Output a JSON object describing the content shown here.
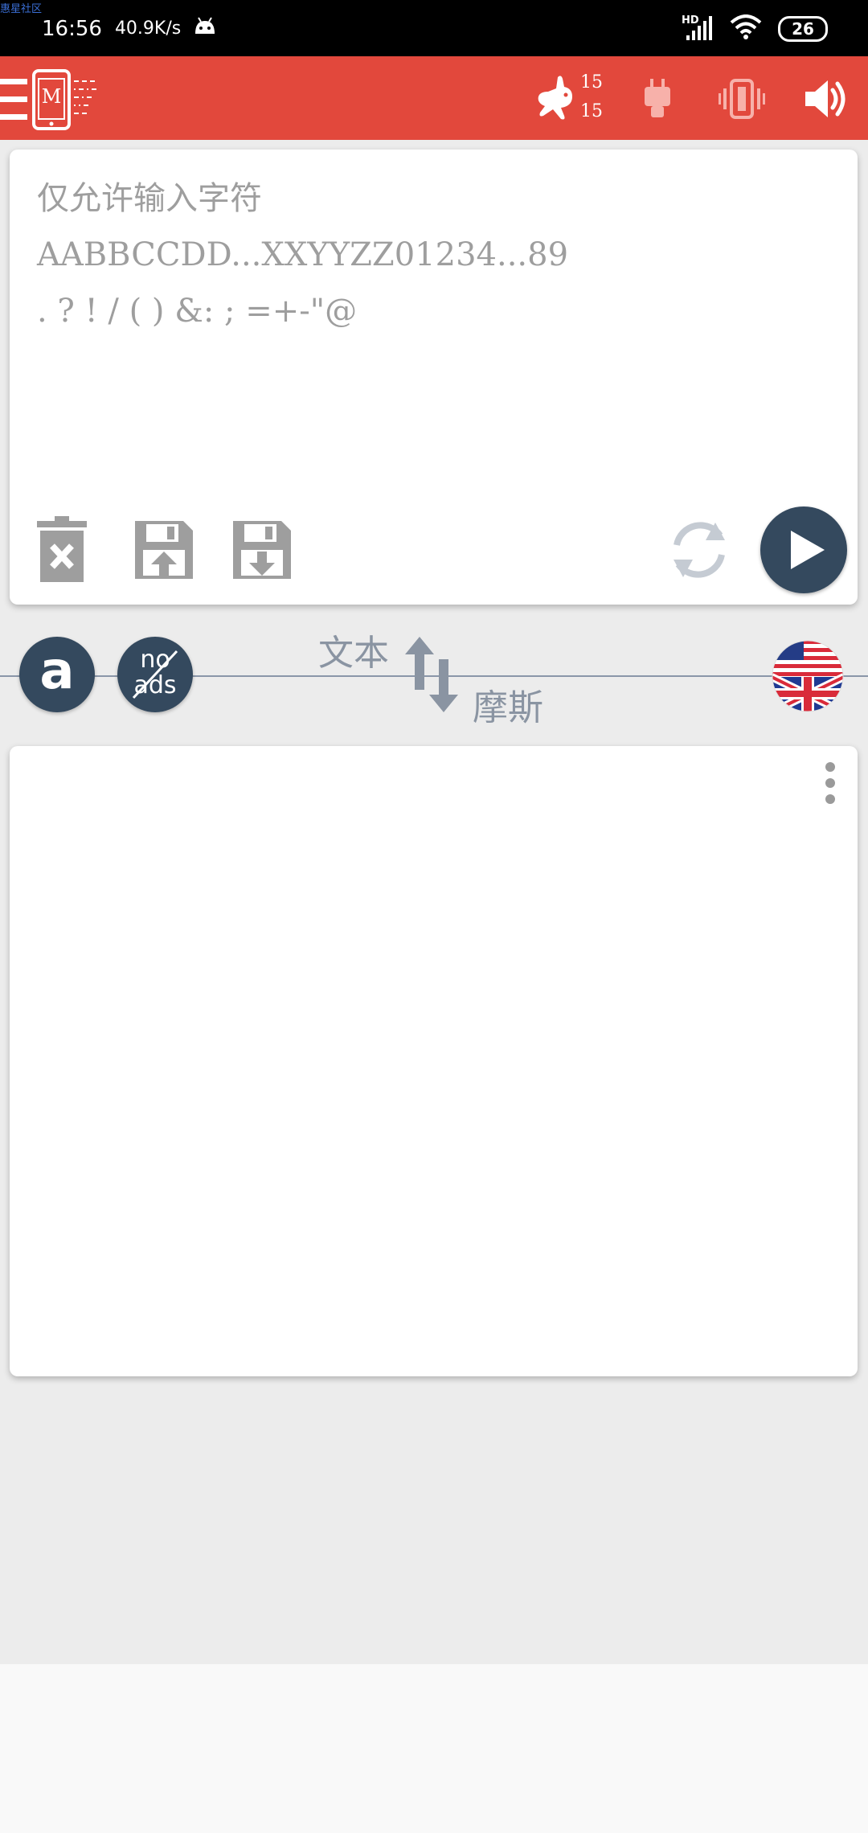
{
  "watermark": "惠星社区",
  "status": {
    "time": "16:56",
    "speed": "40.9K/s",
    "hd": "HD",
    "battery": "26"
  },
  "toolbar": {
    "speed_top": "15",
    "speed_bottom": "15",
    "app_logo_letter": "M"
  },
  "input": {
    "placeholder": "仅允许输入字符\nAABBCCDD...XXYYZZ01234...89\n. ? ! / ( ) &: ; =+-\"@"
  },
  "mode": {
    "a_label": "a",
    "noads_top": "no",
    "noads_bottom": "ads",
    "text_label": "文本",
    "morse_label": "摩斯"
  },
  "colors": {
    "toolbar": "#e2483c",
    "dark_button": "#34495e",
    "icon_gray": "#9e9e9e"
  }
}
